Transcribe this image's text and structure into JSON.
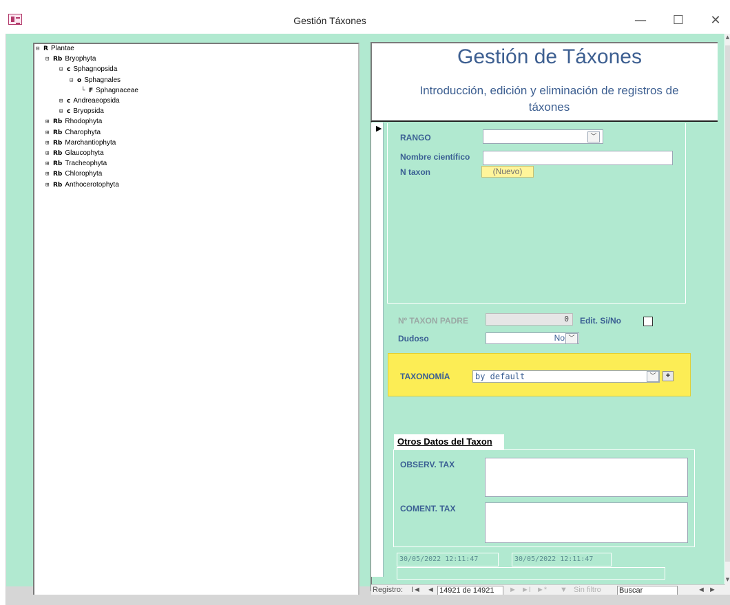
{
  "window": {
    "title": "Gestión Táxones",
    "minimize_glyph": "—",
    "maximize_glyph": "☐",
    "close_glyph": "✕"
  },
  "tree": {
    "nodes": [
      {
        "label": "Plantae",
        "icon": "R",
        "toggle": "⊟"
      },
      {
        "label": "Bryophyta",
        "icon": "Rb",
        "toggle": "⊟"
      },
      {
        "label": "Sphagnopsida",
        "icon": "c",
        "toggle": "⊟"
      },
      {
        "label": "Sphagnales",
        "icon": "o",
        "toggle": "⊟"
      },
      {
        "label": "Sphagnaceae",
        "icon": "F",
        "toggle": "└"
      },
      {
        "label": "Andreaeopsida",
        "icon": "c",
        "toggle": "⊞"
      },
      {
        "label": "Bryopsida",
        "icon": "c",
        "toggle": "⊞"
      },
      {
        "label": "Rhodophyta",
        "icon": "Rb",
        "toggle": "⊞"
      },
      {
        "label": "Charophyta",
        "icon": "Rb",
        "toggle": "⊞"
      },
      {
        "label": "Marchantiophyta",
        "icon": "Rb",
        "toggle": "⊞"
      },
      {
        "label": "Glaucophyta",
        "icon": "Rb",
        "toggle": "⊞"
      },
      {
        "label": "Tracheophyta",
        "icon": "Rb",
        "toggle": "⊞"
      },
      {
        "label": "Chlorophyta",
        "icon": "Rb",
        "toggle": "⊞"
      },
      {
        "label": "Anthocerotophyta",
        "icon": "Rb",
        "toggle": "⊞"
      }
    ]
  },
  "form": {
    "title": "Gestión de Táxones",
    "subtitle": "Introducción, edición y eliminación de registros de táxones",
    "record_selector_glyph": "▶",
    "rango": {
      "label": "RANGO",
      "value": "",
      "dropdown_glyph": "﹀"
    },
    "nombre": {
      "label": "Nombre científico",
      "value": ""
    },
    "n_taxon": {
      "label": "N taxon",
      "value": "(Nuevo)"
    },
    "taxon_padre": {
      "label": "Nº TAXON PADRE",
      "value": "0"
    },
    "edit": {
      "label": "Edit. Si/No",
      "checked": false
    },
    "dudoso": {
      "label": "Dudoso",
      "value": "No",
      "dropdown_glyph": "﹀"
    },
    "taxonomia": {
      "label": "TAXONOMÍA",
      "value": "by default",
      "dropdown_glyph": "﹀",
      "add_glyph": "+"
    },
    "otros": {
      "tab_label": "Otros Datos del Taxon",
      "observ_label": "OBSERV. TAX",
      "observ_value": "",
      "coment_label": "COMENT. TAX",
      "coment_value": ""
    },
    "timestamps": {
      "created": "30/05/2022 12:11:47",
      "modified": "30/05/2022 12:11:47"
    }
  },
  "nav": {
    "record_label": "Registro:",
    "first_glyph": "I◄",
    "prev_glyph": "◄",
    "current": "14921 de 14921",
    "next_glyph": "►",
    "last_glyph": "►I",
    "new_glyph": "►*",
    "filter_icon": "▼",
    "filter_label": "Sin filtro",
    "search_value": "Buscar",
    "left_glyph": "◄",
    "right_glyph": "►"
  },
  "scrollbar": {
    "up_glyph": "▲",
    "down_glyph": "▼"
  },
  "colors": {
    "form_background": "#b1e9d0",
    "title_blue": "#3d5f91",
    "label_blue": "#3a5f93",
    "highlight_yellow": "#fced55",
    "nuevo_yellow": "#fff59b"
  }
}
